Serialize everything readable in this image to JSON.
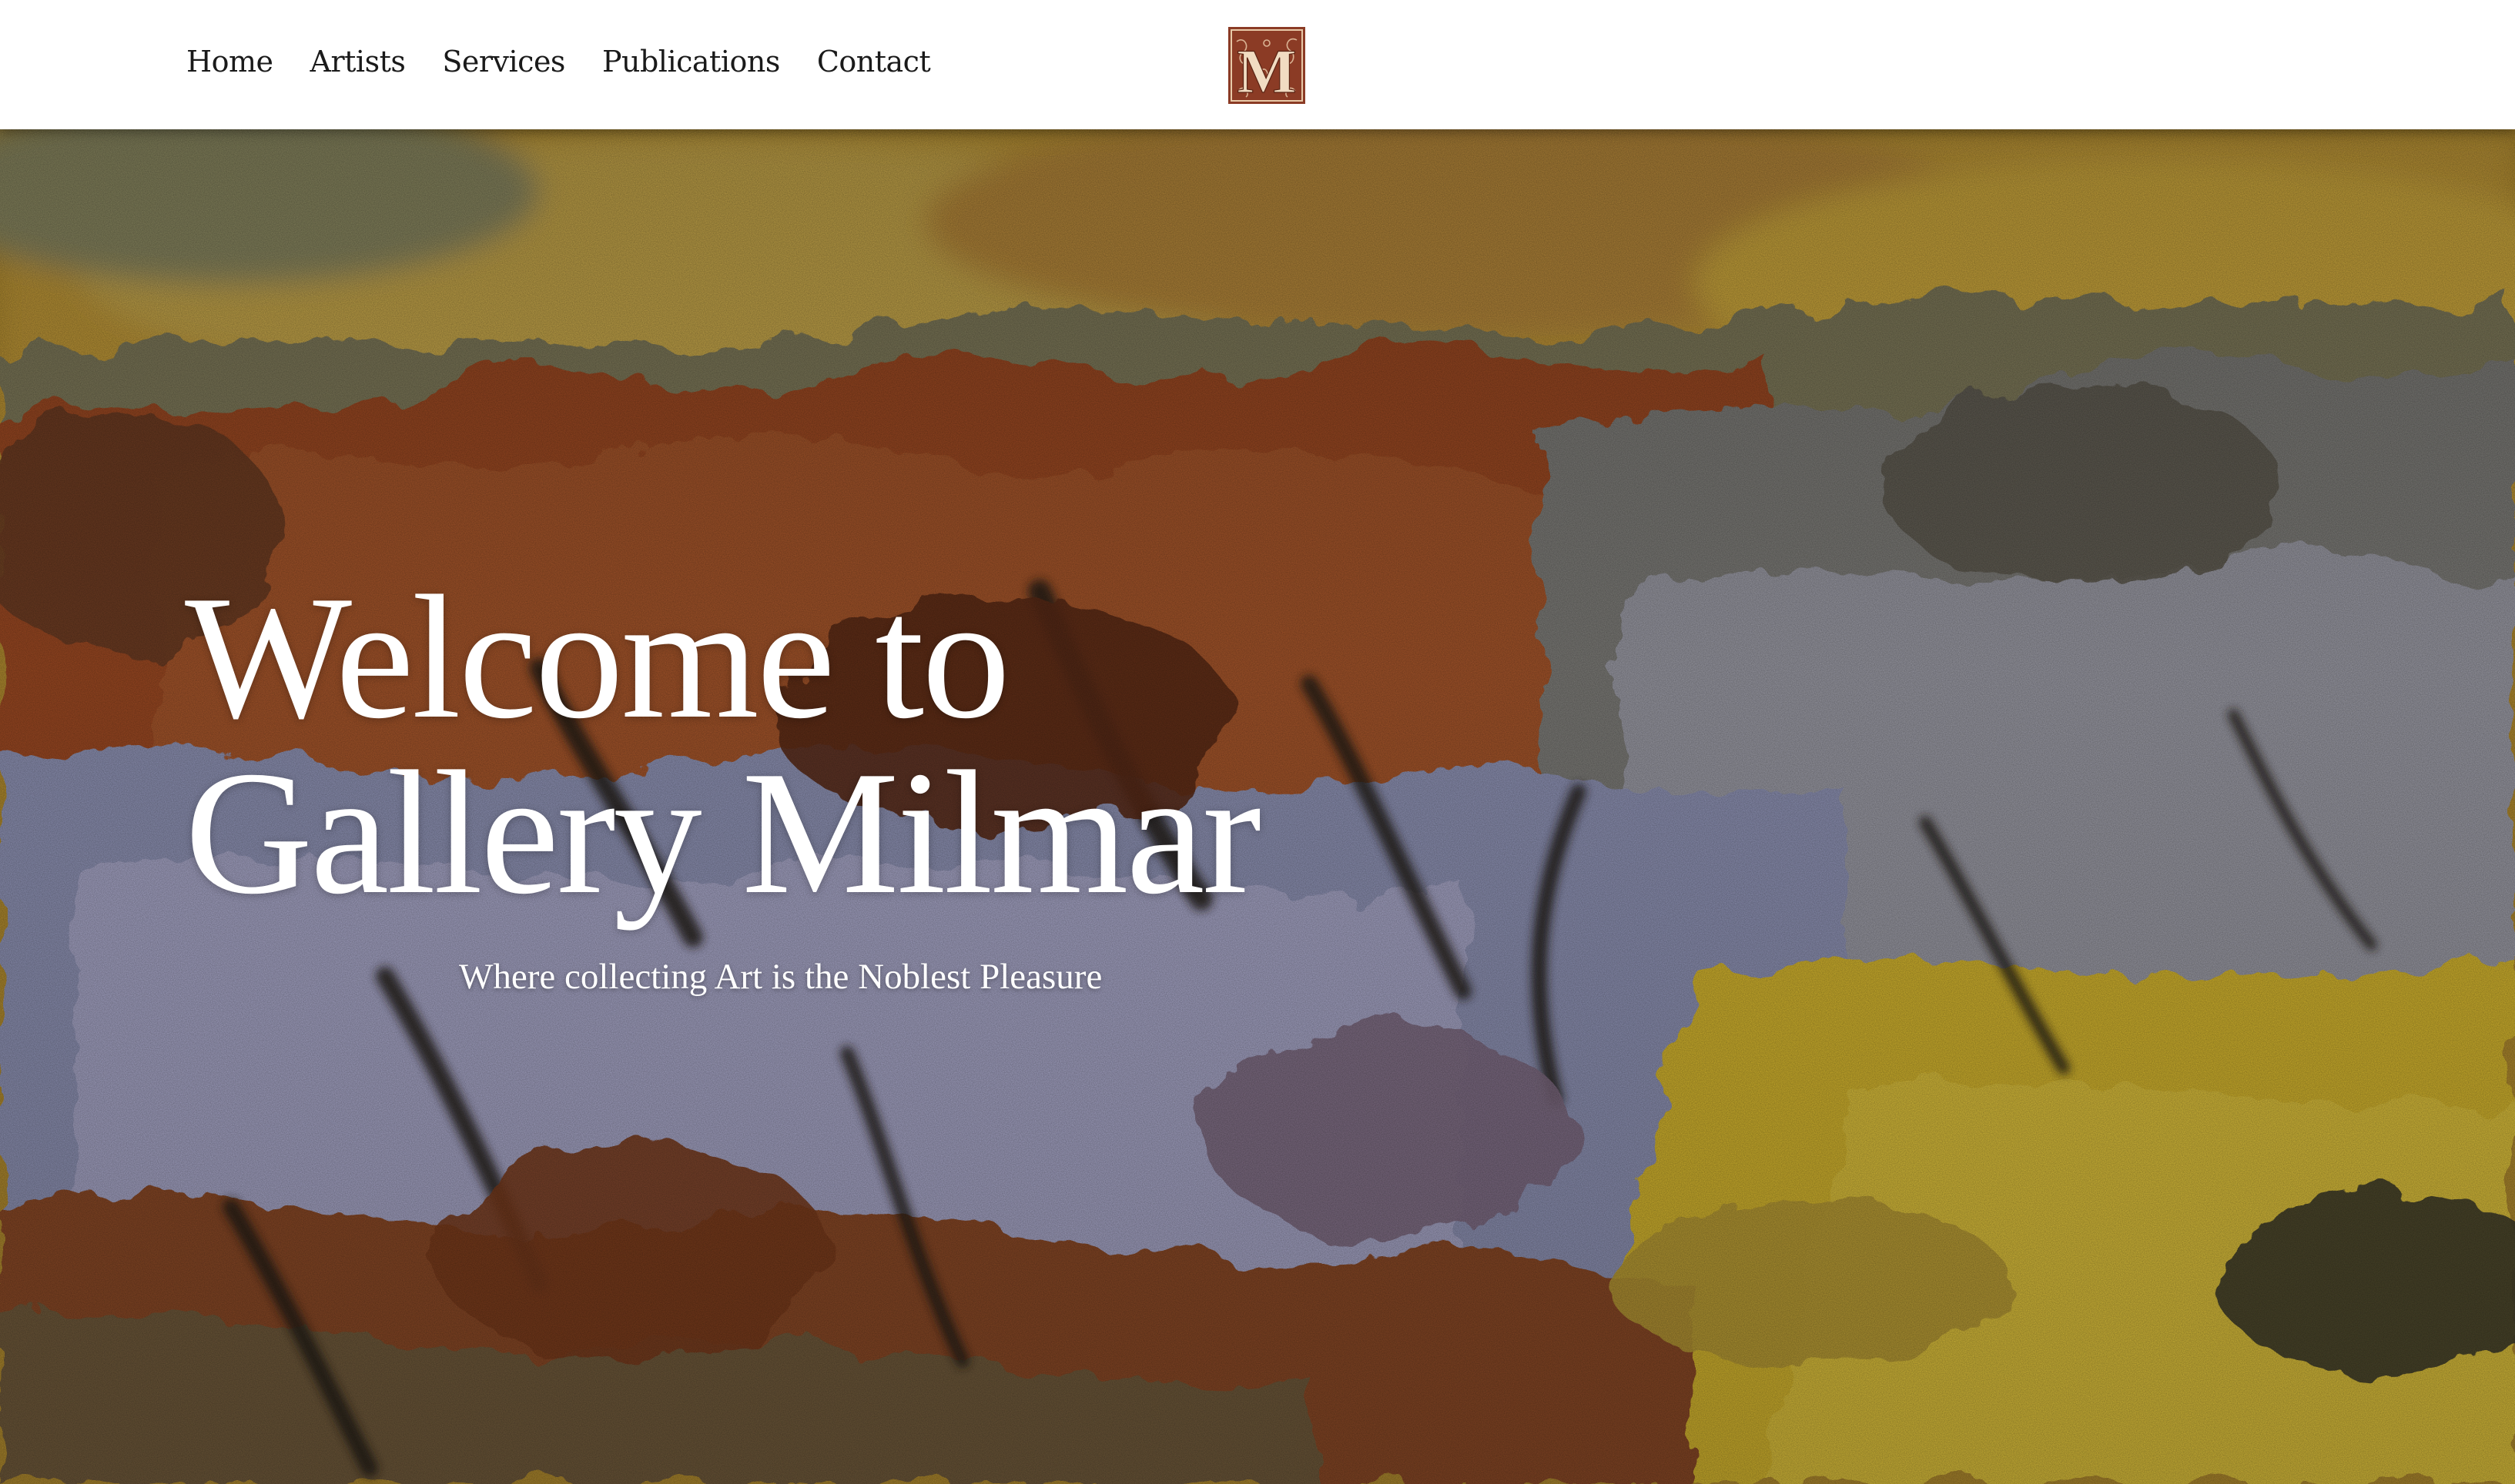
{
  "nav": {
    "items": [
      {
        "label": "Home"
      },
      {
        "label": "Artists"
      },
      {
        "label": "Services"
      },
      {
        "label": "Publications"
      },
      {
        "label": "Contact"
      }
    ]
  },
  "logo": {
    "letter": "M",
    "icon": "illuminated-letter-m-logo",
    "color": "#8b3b25"
  },
  "hero": {
    "title_line1": "Welcome to",
    "title_line2": "Gallery Milmar",
    "subtitle": "Where collecting Art is the Noblest Pleasure",
    "image": "landscape-oil-painting",
    "palette": {
      "ochre": "#c29a33",
      "rust": "#9c4a22",
      "lavender": "#8f94b8",
      "yellow": "#d6b62e",
      "dark": "#2b2118"
    }
  }
}
